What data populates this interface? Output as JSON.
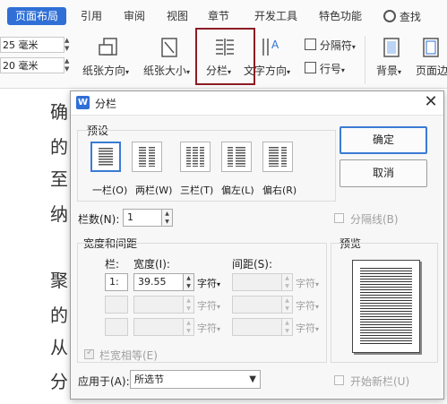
{
  "ribbon": {
    "tabs": [
      "页面布局",
      "引用",
      "审阅",
      "视图",
      "章节",
      "开发工具",
      "特色功能"
    ],
    "search_label": "查找",
    "margin_top_value": "25 毫米",
    "margin_bottom_value": "20 毫米",
    "orientation_label": "纸张方向",
    "size_label": "纸张大小",
    "columns_label": "分栏",
    "text_direction_label": "文字方向",
    "hyphenation_label": "分隔符",
    "line_numbers_label": "行号",
    "background_label": "背景",
    "page_border_label": "页面边"
  },
  "document": {
    "lines": [
      "确",
      "的",
      "至",
      "纳",
      "聚",
      "的",
      "从",
      "分"
    ]
  },
  "dialog": {
    "title": "分栏",
    "presets_label": "预设",
    "presets": [
      "一栏(O)",
      "两栏(W)",
      "三栏(T)",
      "偏左(L)",
      "偏右(R)"
    ],
    "ok_label": "确定",
    "cancel_label": "取消",
    "num_columns_label": "栏数(N):",
    "num_columns_value": "1",
    "separator_label": "分隔线(B)",
    "width_spacing_label": "宽度和间距",
    "col_header": "栏:",
    "width_header": "宽度(I):",
    "spacing_header": "间距(S):",
    "row1_col": "1:",
    "row1_width": "39.55",
    "unit_label": "字符",
    "unit_dim": "字符",
    "equal_width_label": "栏宽相等(E)",
    "preview_label": "预览",
    "apply_label": "应用于(A):",
    "apply_value": "所选节",
    "new_column_label": "开始新栏(U)"
  },
  "colors": {
    "accent": "#2f6fd6",
    "highlight": "#8c1c24",
    "ok_border": "#3a7bd5"
  }
}
